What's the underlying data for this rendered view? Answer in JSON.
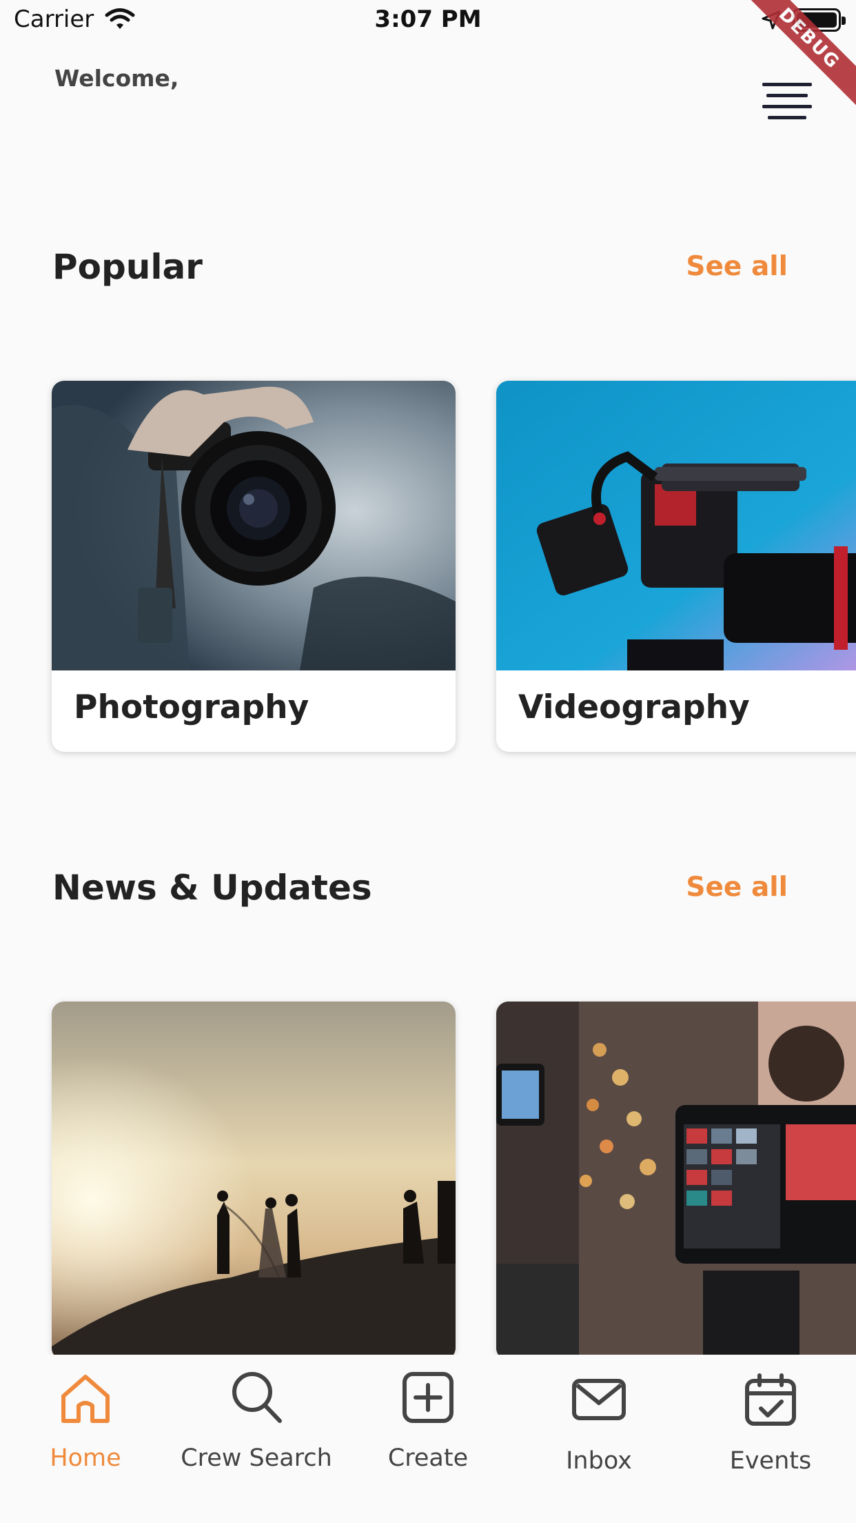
{
  "status_bar": {
    "carrier": "Carrier",
    "time": "3:07 PM",
    "icons": [
      "wifi-icon",
      "location-arrow-icon",
      "battery-icon"
    ]
  },
  "debug_banner": "DEBUG",
  "header": {
    "welcome": "Welcome,",
    "menu_icon": "hamburger-menu-icon"
  },
  "popular": {
    "title": "Popular",
    "see_all": "See all",
    "cards": [
      {
        "label": "Photography"
      },
      {
        "label": "Videography"
      }
    ]
  },
  "news": {
    "title": "News & Updates",
    "see_all": "See all"
  },
  "bottom_nav": {
    "items": [
      {
        "label": "Home",
        "icon": "home-icon",
        "active": true
      },
      {
        "label": "Crew Search",
        "icon": "search-icon",
        "active": false
      },
      {
        "label": "Create",
        "icon": "plus-square-icon",
        "active": false
      },
      {
        "label": "Inbox",
        "icon": "mail-icon",
        "active": false
      },
      {
        "label": "Events",
        "icon": "calendar-check-icon",
        "active": false
      }
    ]
  },
  "colors": {
    "accent": "#ef8a3c",
    "background": "#fafafa",
    "debug": "#b03036"
  }
}
